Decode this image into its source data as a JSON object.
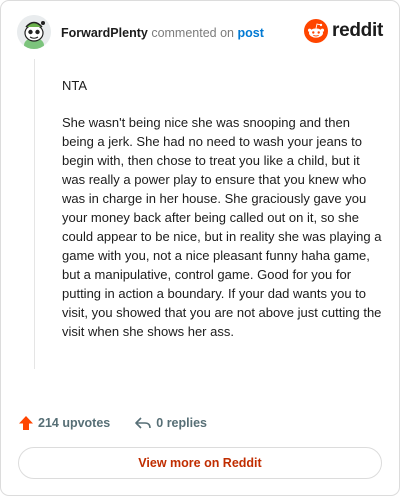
{
  "header": {
    "author": "ForwardPlenty",
    "action": "commented on",
    "post_link": "post",
    "brand": "reddit"
  },
  "comment": {
    "paragraphs": [
      "NTA",
      "She wasn't being nice she was snooping and then being a jerk. She had no need to wash your jeans to begin with, then chose to treat you like a child, but it was really a power play to ensure that you knew who was in charge in her house. She graciously gave you your money back after being called out on it, so she could appear to be nice, but in reality she was playing a game with you, not a nice pleasant funny haha game, but a manipulative, control game. Good for you for putting in action a boundary. If your dad wants you to visit, you showed that you are not above just cutting the visit when she shows her ass."
    ]
  },
  "footer": {
    "upvotes": "214 upvotes",
    "replies": "0 replies",
    "view_more": "View more on Reddit"
  },
  "colors": {
    "reddit_orange": "#ff4500",
    "link_blue": "#0079d3",
    "view_more_text": "#c02d00"
  },
  "icons": [
    "avatar-snoo",
    "reddit-logo-icon",
    "upvote-arrow-icon",
    "reply-arrow-icon"
  ]
}
